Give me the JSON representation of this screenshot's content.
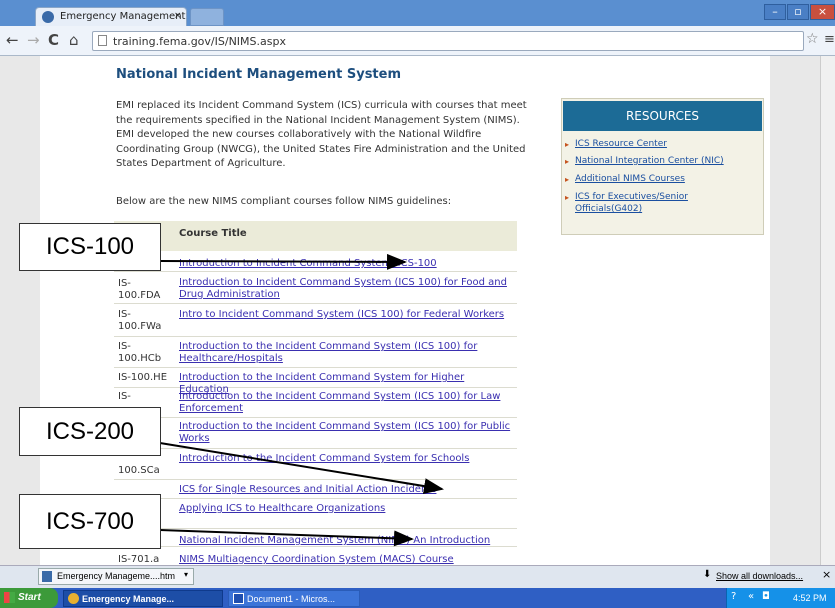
{
  "browser": {
    "tab_title": "Emergency Management Insti",
    "url": "training.fema.gov/IS/NIMS.aspx"
  },
  "page": {
    "title": "National Incident Management System",
    "intro": "EMI replaced its Incident Command System (ICS) curricula with courses that meet the requirements specified in the National Incident Management System (NIMS). EMI developed the new courses collaboratively with the National Wildfire Coordinating Group (NWCG), the United States Fire Administration and the United States Department of Agriculture.",
    "intro2": "Below are the new NIMS compliant courses follow NIMS guidelines:",
    "col_title": "Course Title",
    "rows": [
      {
        "code": "",
        "title": "Introduction to Incident Command System, ICS-100"
      },
      {
        "code": "IS-\n100.FDA",
        "title": "Introduction to Incident Command System (ICS 100) for Food and Drug Administration"
      },
      {
        "code": "IS-\n100.FWa",
        "title": "Intro to Incident Command System (ICS 100) for Federal Workers"
      },
      {
        "code": "IS-\n100.HCb",
        "title": "Introduction to the Incident Command System (ICS 100) for Healthcare/Hospitals"
      },
      {
        "code": "IS-100.HE",
        "title": "Introduction to the Incident Command System for Higher Education"
      },
      {
        "code": "IS-",
        "title": "Introduction to the Incident Command System (ICS 100) for Law Enforcement"
      },
      {
        "code": "",
        "title": "Introduction to the Incident Command System (ICS 100) for Public Works"
      },
      {
        "code": "100.SCa",
        "title": "Introduction to the Incident Command System for Schools"
      },
      {
        "code": "",
        "title": "ICS for Single Resources and Initial Action Incidents"
      },
      {
        "code": "",
        "title": "Applying ICS to Healthcare Organizations"
      },
      {
        "code": "",
        "title": "National Incident Management System (NIMS) An Introduction"
      },
      {
        "code": "IS-701.a",
        "title": "NIMS Multiagency Coordination System (MACS) Course"
      }
    ]
  },
  "resources": {
    "heading": "RESOURCES",
    "items": [
      "ICS Resource Center",
      "National Integration Center (NIC)",
      "Additional NIMS Courses",
      "ICS for Executives/Senior Officials(G402)"
    ]
  },
  "callouts": {
    "c1": "ICS-100",
    "c2": "ICS-200",
    "c3": "ICS-700"
  },
  "downloads": {
    "file": "Emergency Manageme....htm",
    "show_all": "Show all downloads..."
  },
  "taskbar": {
    "start": "Start",
    "items": [
      "Emergency Manage...",
      "Document1 - Micros..."
    ],
    "clock": "4:52 PM"
  }
}
